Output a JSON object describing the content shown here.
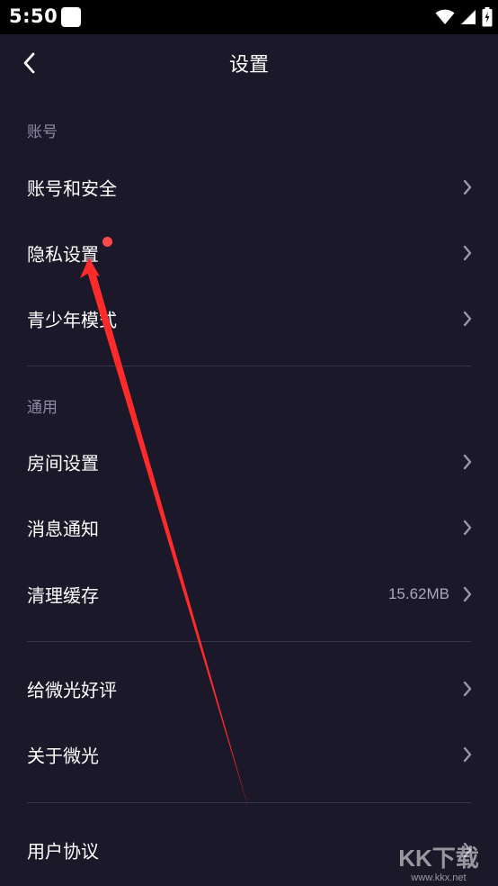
{
  "status_bar": {
    "time": "5:50",
    "icons": [
      "app-square-icon",
      "wifi-icon",
      "signal-icon",
      "battery-charging-icon"
    ]
  },
  "nav": {
    "title": "设置",
    "back_icon": "chevron-left-icon"
  },
  "sections": [
    {
      "header": "账号",
      "items": [
        {
          "label": "账号和安全"
        },
        {
          "label": "隐私设置",
          "badge": "red-dot"
        },
        {
          "label": "青少年模式"
        }
      ]
    },
    {
      "header": "通用",
      "items": [
        {
          "label": "房间设置"
        },
        {
          "label": "消息通知"
        },
        {
          "label": "清理缓存",
          "value": "15.62MB"
        }
      ]
    },
    {
      "header": "",
      "items": [
        {
          "label": "给微光好评"
        },
        {
          "label": "关于微光"
        }
      ]
    },
    {
      "header": "",
      "items": [
        {
          "label": "用户协议"
        }
      ]
    }
  ],
  "colors": {
    "background": "#1b1829",
    "section_header": "#8e8aa6",
    "divider": "#38354a",
    "badge": "#ff4a4a",
    "annotation_arrow": "#ff2a2a"
  },
  "watermark": {
    "text": "KK下载",
    "url_text": "www.kkx.net"
  }
}
